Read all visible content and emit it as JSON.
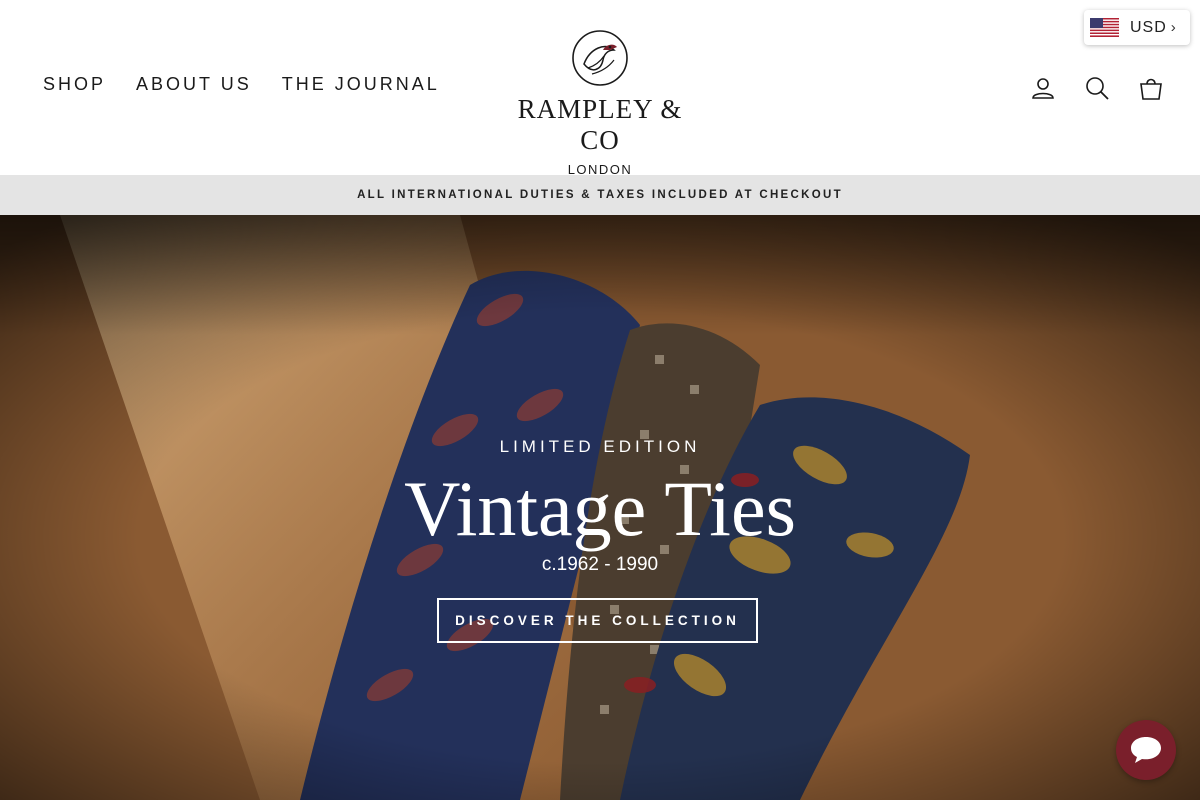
{
  "nav": {
    "left_links": [
      "SHOP",
      "ABOUT US",
      "THE JOURNAL"
    ],
    "right_icons": [
      "account-icon",
      "search-icon",
      "cart-icon"
    ]
  },
  "logo": {
    "name": "RAMPLEY & CO",
    "city": "LONDON"
  },
  "currency": {
    "code": "USD",
    "flag": "us-flag-icon"
  },
  "announcement": {
    "text": "ALL INTERNATIONAL DUTIES & TAXES INCLUDED AT CHECKOUT"
  },
  "hero": {
    "kicker": "LIMITED EDITION",
    "title": "Vintage Ties",
    "subtitle": "c.1962 - 1990",
    "cta": "DISCOVER THE COLLECTION"
  },
  "colors": {
    "brand_accent": "#7a1f2b",
    "announcement_bg": "#e4e4e4",
    "text_dark": "#1a1a1a"
  }
}
